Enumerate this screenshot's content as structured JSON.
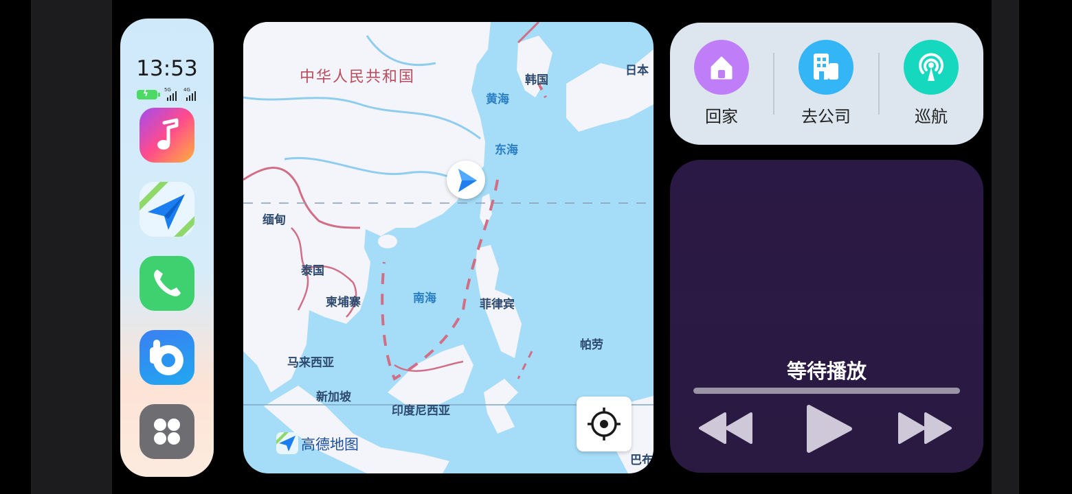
{
  "status": {
    "time": "13:53",
    "network_1": "5G",
    "network_2": "4G"
  },
  "dock": {
    "apps": [
      {
        "name": "music",
        "icon": "music-note-icon"
      },
      {
        "name": "navigation",
        "icon": "paper-plane-icon"
      },
      {
        "name": "phone",
        "icon": "phone-icon"
      },
      {
        "name": "assistant",
        "icon": "assistant-b-icon"
      },
      {
        "name": "more",
        "icon": "apps-grid-icon"
      }
    ]
  },
  "map": {
    "labels": {
      "china": "中华人民共和国",
      "korea": "韩国",
      "japan": "日本",
      "yellow_sea": "黄海",
      "east_sea": "东海",
      "myanmar": "缅甸",
      "thailand": "泰国",
      "cambodia": "柬埔寨",
      "south_sea": "南海",
      "philippines": "菲律宾",
      "palau": "帕劳",
      "malaysia": "马来西亚",
      "singapore": "新加坡",
      "indonesia": "印度尼西亚",
      "papua": "巴布"
    },
    "brand": "高德地图",
    "locate_icon": "crosshair-icon",
    "position_icon": "navigation-arrow-icon"
  },
  "quick_actions": [
    {
      "label": "回家",
      "icon": "home-icon",
      "color": "#bf7ef8"
    },
    {
      "label": "去公司",
      "icon": "office-building-icon",
      "color": "#34b5f5"
    },
    {
      "label": "巡航",
      "icon": "broadcast-tower-icon",
      "color": "#16d8bf"
    }
  ],
  "media": {
    "title": "等待播放",
    "progress": 0,
    "controls": [
      "rewind-icon",
      "play-icon",
      "fast-forward-icon"
    ]
  }
}
